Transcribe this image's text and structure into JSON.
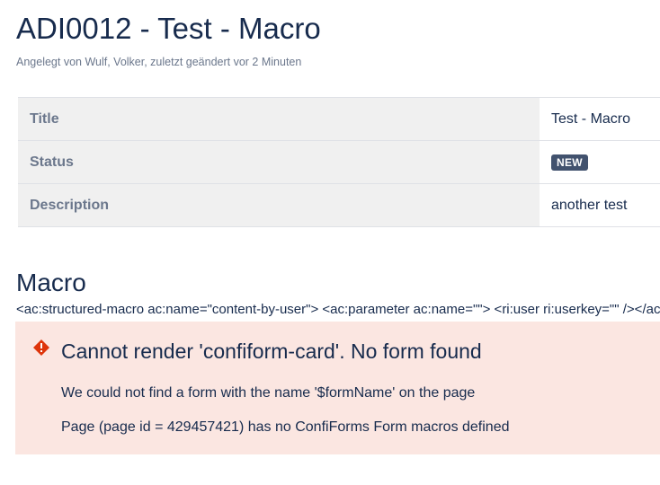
{
  "page": {
    "title": "ADI0012 - Test - Macro",
    "byline": "Angelegt von Wulf, Volker, zuletzt geändert vor 2 Minuten"
  },
  "properties": [
    {
      "key": "Title",
      "value": "Test - Macro"
    },
    {
      "key": "Status",
      "value": "NEW"
    },
    {
      "key": "Description",
      "value": "another test"
    }
  ],
  "colors": {
    "status_badge": "#42526e",
    "error_background": "#fbe6e1",
    "error_icon": "#de350b"
  },
  "macro_section": {
    "heading": "Macro",
    "raw_markup": "<ac:structured-macro ac:name=\"content-by-user\"> <ac:parameter ac:name=\"\"> <ri:user ri:userkey=\"\" /></ac:parameter></ac:structured-macro>"
  },
  "error": {
    "icon": "error-icon",
    "title": "Cannot render 'confiform-card'. No form found",
    "line1": "We could not find a form with the name '$formName' on the page",
    "line2": "Page (page id = 429457421) has no ConfiForms Form macros defined"
  }
}
